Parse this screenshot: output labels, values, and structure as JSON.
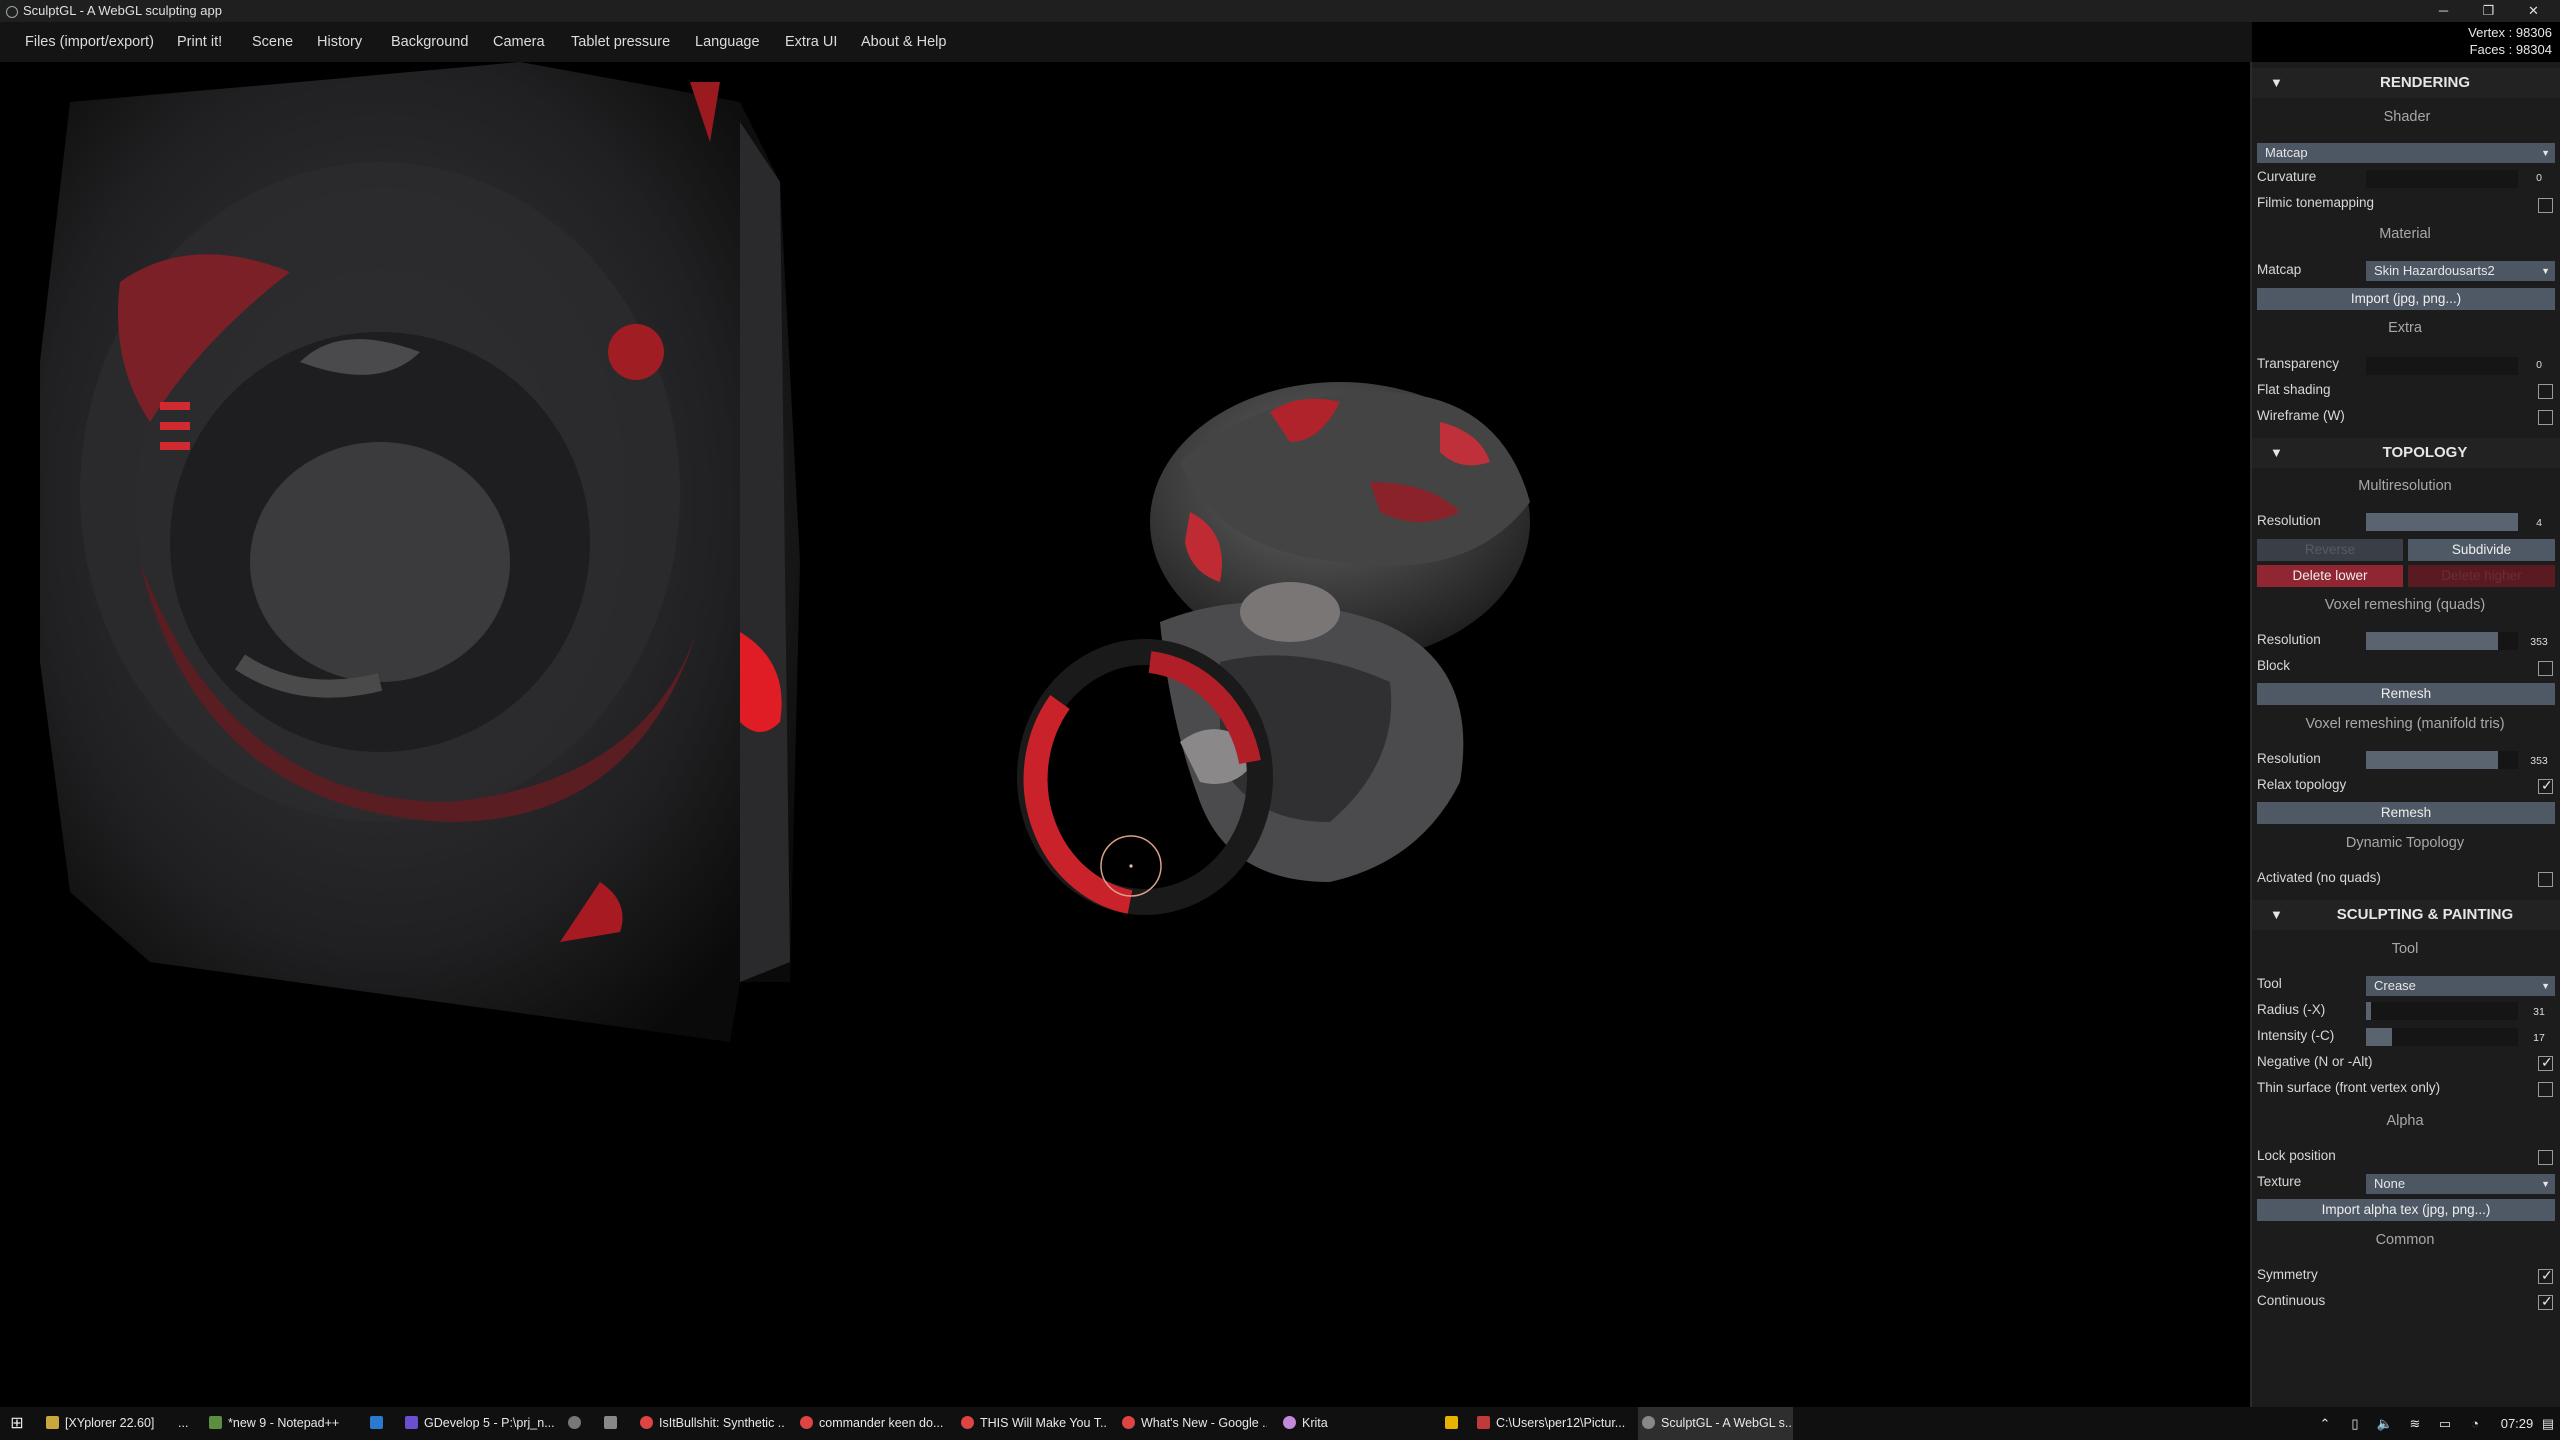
{
  "window": {
    "title": "SculptGL - A WebGL sculpting app",
    "minimize_glyph": "─",
    "maximize_glyph": "❐",
    "close_glyph": "✕"
  },
  "menu": {
    "items": [
      "Files (import/export)",
      "Print it!",
      "Scene",
      "History",
      "Background",
      "Camera",
      "Tablet pressure",
      "Language",
      "Extra UI",
      "About & Help"
    ]
  },
  "stats": {
    "vertex": "Vertex : 98306",
    "faces": "Faces : 98304"
  },
  "rendering": {
    "header": "RENDERING",
    "shader_title": "Shader",
    "shader_value": "Matcap",
    "curvature_label": "Curvature",
    "curvature_value": "0",
    "filmic_label": "Filmic tonemapping",
    "filmic_checked": false,
    "material_title": "Material",
    "matcap_label": "Matcap",
    "matcap_value": "Skin Hazardousarts2",
    "import_button": "Import (jpg, png...)",
    "extra_title": "Extra",
    "transparency_label": "Transparency",
    "transparency_value": "0",
    "flat_label": "Flat shading",
    "flat_checked": false,
    "wireframe_label": "Wireframe (W)",
    "wireframe_checked": false
  },
  "topology": {
    "header": "TOPOLOGY",
    "multires_title": "Multiresolution",
    "resolution_label": "Resolution",
    "resolution_value": "4",
    "reverse_button": "Reverse",
    "subdivide_button": "Subdivide",
    "delete_lower_button": "Delete lower",
    "delete_higher_button": "Delete higher",
    "voxel_quads_title": "Voxel remeshing (quads)",
    "voxel_quads_resolution_label": "Resolution",
    "voxel_quads_resolution_value": "353",
    "block_label": "Block",
    "block_checked": false,
    "remesh_button": "Remesh",
    "voxel_tris_title": "Voxel remeshing (manifold tris)",
    "voxel_tris_resolution_label": "Resolution",
    "voxel_tris_resolution_value": "353",
    "relax_label": "Relax topology",
    "relax_checked": true,
    "remesh2_button": "Remesh",
    "dynamic_title": "Dynamic Topology",
    "activated_label": "Activated (no quads)",
    "activated_checked": false
  },
  "sculpting": {
    "header": "SCULPTING & PAINTING",
    "tool_title": "Tool",
    "tool_label": "Tool",
    "tool_value": "Crease",
    "radius_label": "Radius (-X)",
    "radius_value": "31",
    "intensity_label": "Intensity (-C)",
    "intensity_value": "17",
    "negative_label": "Negative (N or -Alt)",
    "negative_checked": true,
    "thin_label": "Thin surface (front vertex only)",
    "thin_checked": false,
    "alpha_title": "Alpha",
    "lock_label": "Lock position",
    "lock_checked": false,
    "texture_label": "Texture",
    "texture_value": "None",
    "import_alpha_button": "Import alpha tex (jpg, png...)",
    "common_title": "Common",
    "symmetry_label": "Symmetry",
    "symmetry_checked": true,
    "continuous_label": "Continuous",
    "continuous_checked": true
  },
  "sliders": {
    "curvature": 0,
    "transparency": 0,
    "multires_resolution": 1.0,
    "voxel_quads_resolution": 0.87,
    "voxel_tris_resolution": 0.87,
    "radius": 0.03,
    "intensity": 0.17
  },
  "taskbar": {
    "items": [
      "[XYplorer 22.60]",
      "...",
      "*new 9 - Notepad++",
      "",
      "GDevelop 5 - P:\\prj_n...",
      "",
      "",
      "IsItBullshit: Synthetic ...",
      "commander keen do...",
      "THIS Will Make You T...",
      "What's New - Google ...",
      "Krita",
      "",
      "C:\\Users\\per12\\Pictur...",
      "SculptGL - A WebGL s..."
    ],
    "clock": "07:29"
  },
  "colors": {
    "accent_red": "#8f2631",
    "button_blue": "#4f5966",
    "panel_bg": "#1c1c1c"
  }
}
